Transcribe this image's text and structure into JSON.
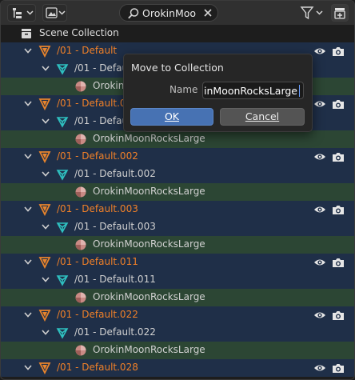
{
  "header": {
    "search_value": "OrokinMoo",
    "icons": [
      "outliner-display-mode-icon",
      "view-filter-icon",
      "search-icon",
      "clear-icon",
      "funnel-filter-icon",
      "new-collection-icon"
    ]
  },
  "tree": {
    "root_label": "Scene Collection",
    "rows": [
      {
        "label": "/01 - Default",
        "kind": "collection"
      },
      {
        "label": "/01 - Default",
        "kind": "mesh"
      },
      {
        "label": "OrokinMoonRocksLarge",
        "kind": "material"
      },
      {
        "label": "/01 - Default.001",
        "kind": "collection"
      },
      {
        "label": "/01 - Default.001",
        "kind": "mesh"
      },
      {
        "label": "OrokinMoonRocksLarge",
        "kind": "material"
      },
      {
        "label": "/01 - Default.002",
        "kind": "collection"
      },
      {
        "label": "/01 - Default.002",
        "kind": "mesh"
      },
      {
        "label": "OrokinMoonRocksLarge",
        "kind": "material"
      },
      {
        "label": "/01 - Default.003",
        "kind": "collection"
      },
      {
        "label": "/01 - Default.003",
        "kind": "mesh"
      },
      {
        "label": "OrokinMoonRocksLarge",
        "kind": "material"
      },
      {
        "label": "/01 - Default.011",
        "kind": "collection"
      },
      {
        "label": "/01 - Default.011",
        "kind": "mesh"
      },
      {
        "label": "OrokinMoonRocksLarge",
        "kind": "material"
      },
      {
        "label": "/01 - Default.022",
        "kind": "collection"
      },
      {
        "label": "/01 - Default.022",
        "kind": "mesh"
      },
      {
        "label": "OrokinMoonRocksLarge",
        "kind": "material"
      },
      {
        "label": "/01 - Default.028",
        "kind": "collection"
      }
    ]
  },
  "popup": {
    "title": "Move to Collection",
    "name_label": "Name",
    "name_value": "inMoonRocksLarge",
    "ok_label": "OK",
    "cancel_label": "Cancel"
  },
  "colors": {
    "collection_text": "#f08028",
    "mesh_icon": "#2fc0c0",
    "object_icon": "#e8842c",
    "selected_row": "#1f2f48",
    "highlight_row": "#2c4634",
    "ok_button": "#4772b3"
  }
}
